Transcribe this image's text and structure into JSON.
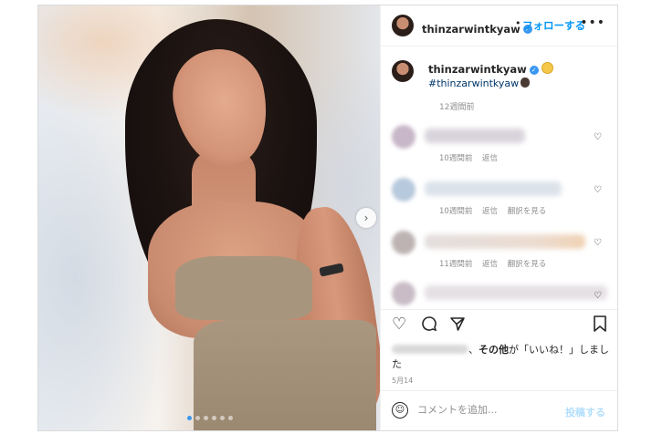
{
  "header": {
    "username": "thinzarwintkyaw",
    "follow_dot": "•",
    "follow_label": "フォローする",
    "more_label": "•••"
  },
  "caption": {
    "username": "thinzarwintkyaw",
    "hashtag": "#thinzarwintkyaw",
    "timestamp": "12週間前"
  },
  "comments": [
    {
      "time": "10週間前",
      "reply": "返信",
      "translate": ""
    },
    {
      "time": "10週間前",
      "reply": "返信",
      "translate": "翻訳を見る"
    },
    {
      "time": "11週間前",
      "reply": "返信",
      "translate": "翻訳を見る"
    },
    {
      "time": "",
      "reply": "",
      "translate": ""
    }
  ],
  "likes": {
    "suffix_bold": "その他",
    "suffix_text": "が「いいね！」しました"
  },
  "date": "5月14",
  "comment_bar": {
    "placeholder": "コメントを追加...",
    "post_label": "投稿する"
  },
  "icons": {
    "heart": "heart-icon",
    "comment": "comment-icon",
    "share": "share-icon",
    "save": "bookmark-icon",
    "emoji": "emoji-icon",
    "next": "chevron-right-icon"
  },
  "colors": {
    "accent": "#0095f6",
    "post_disabled": "#b2dffc",
    "muted": "#8e8e8e",
    "verified": "#3897f0"
  }
}
